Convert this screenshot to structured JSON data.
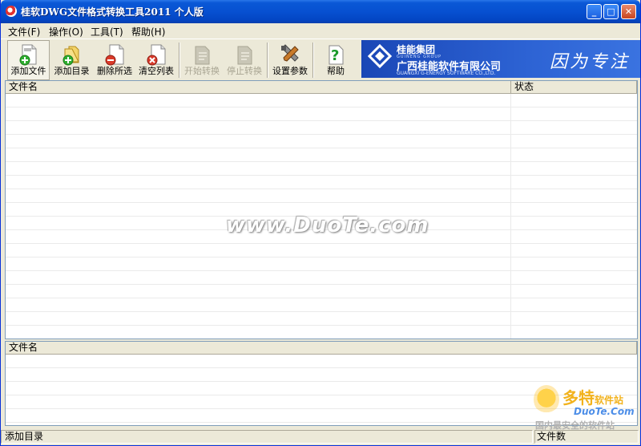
{
  "window": {
    "title": "桂软DWG文件格式转换工具2011 个人版",
    "controls": {
      "minimize": "_",
      "maximize": "□",
      "close": "✕"
    }
  },
  "menu": [
    {
      "label": "文件(F)"
    },
    {
      "label": "操作(O)"
    },
    {
      "label": "工具(T)"
    },
    {
      "label": "帮助(H)"
    }
  ],
  "toolbar": {
    "add_file": "添加文件",
    "add_dir": "添加目录",
    "delete_selected": "删除所选",
    "clear_list": "清空列表",
    "start_convert": "开始转换",
    "stop_convert": "停止转换",
    "settings": "设置参数",
    "help": "帮助"
  },
  "banner": {
    "group": "桂能集团",
    "group_en": "GUINENG GROUP",
    "company": "广西桂能软件有限公司",
    "company_en": "GUANGXI G-ENERGY SOFTWARE CO.,LTD.",
    "slogan": "因为专注"
  },
  "file_list": {
    "col_filename": "文件名",
    "col_status": "状态"
  },
  "output_list": {
    "col_filename": "文件名"
  },
  "watermark": "www.DuoTe.com",
  "corner_watermark": {
    "brand": "多特",
    "brand_sub": "软件站",
    "site": "DuoTe.Com",
    "tagline": "国内最安全的软件站"
  },
  "statusbar": {
    "left": "添加目录",
    "right": "文件数"
  },
  "colors": {
    "titlebar": "#0a58d6",
    "chrome": "#ece9d8",
    "banner": "#2d63d4",
    "green_badge": "#2fae2f",
    "red_badge": "#d93a2a"
  }
}
